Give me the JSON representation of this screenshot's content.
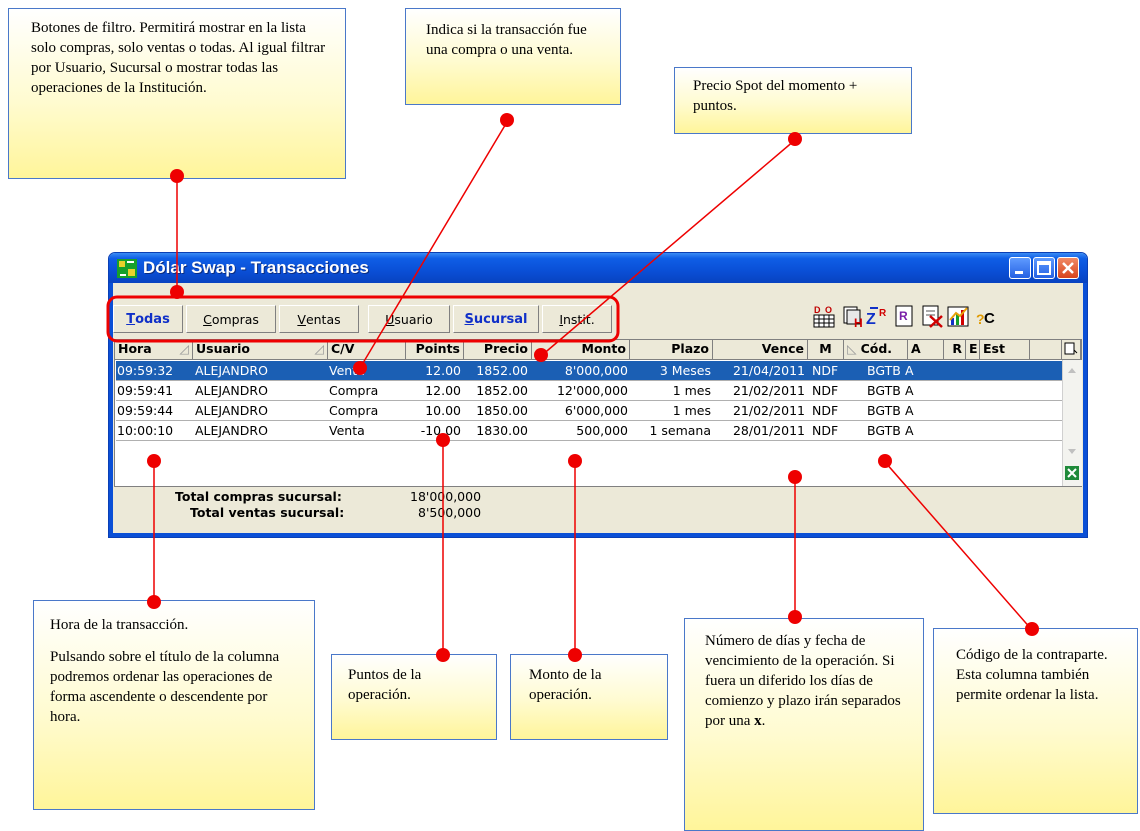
{
  "notes": {
    "filtros": "Botones de filtro. Permitirá mostrar en la lista solo compras, solo ventas o todas. Al igual filtrar por Usuario, Sucursal o mostrar todas las operaciones de la Institución.",
    "cv": "Indica si la transacción fue una compra o una venta.",
    "precio": "Precio Spot del momento + puntos.",
    "hora_p1": "Hora de la transacción.",
    "hora_p2": "Pulsando sobre el título de la columna podremos ordenar las operaciones de forma ascendente o descendente por hora.",
    "puntos": "Puntos de la operación.",
    "monto": "Monto de la operación.",
    "plazo_pre": "Número de días y fecha de vencimiento de la operación. Si fuera un diferido los días de comienzo y plazo irán separados por una ",
    "plazo_bold": "x",
    "plazo_post": ".",
    "codigo": "Código de la contraparte. Esta columna también permite ordenar la lista."
  },
  "window": {
    "title": "Dólar Swap - Transacciones"
  },
  "toolbar": {
    "todas": {
      "ul": "T",
      "rest": "odas"
    },
    "compras": {
      "ul": "C",
      "rest": "ompras"
    },
    "ventas": {
      "ul": "V",
      "rest": "entas"
    },
    "usuario": {
      "ul": "U",
      "rest": "suario"
    },
    "sucursal": {
      "ul": "S",
      "rest": "ucursal"
    },
    "instit": {
      "ul": "I",
      "rest": "nstit."
    }
  },
  "table": {
    "headers": {
      "hora": "Hora",
      "usuario": "Usuario",
      "cv": "C/V",
      "points": "Points",
      "precio": "Precio",
      "monto": "Monto",
      "plazo": "Plazo",
      "vence": "Vence",
      "m": "M",
      "cod": "Cód.",
      "a": "A",
      "r": "R",
      "e": "E",
      "est": "Est"
    },
    "rows": [
      {
        "hora": "09:59:32",
        "usuario": "ALEJANDRO",
        "cv": "Venta",
        "points": "12.00",
        "precio": "1852.00",
        "monto": "8'000,000",
        "plazo": "3 Meses",
        "vence": "21/04/2011",
        "m": "NDF",
        "cod": "BGTB",
        "a": "A"
      },
      {
        "hora": "09:59:41",
        "usuario": "ALEJANDRO",
        "cv": "Compra",
        "points": "12.00",
        "precio": "1852.00",
        "monto": "12'000,000",
        "plazo": "1 mes",
        "vence": "21/02/2011",
        "m": "NDF",
        "cod": "BGTB",
        "a": "A"
      },
      {
        "hora": "09:59:44",
        "usuario": "ALEJANDRO",
        "cv": "Compra",
        "points": "10.00",
        "precio": "1850.00",
        "monto": "6'000,000",
        "plazo": "1 mes",
        "vence": "21/02/2011",
        "m": "NDF",
        "cod": "BGTB",
        "a": "A"
      },
      {
        "hora": "10:00:10",
        "usuario": "ALEJANDRO",
        "cv": "Venta",
        "points": "-10.00",
        "precio": "1830.00",
        "monto": "500,000",
        "plazo": "1 semana",
        "vence": "28/01/2011",
        "m": "NDF",
        "cod": "BGTB",
        "a": "A"
      }
    ]
  },
  "totals": {
    "compras_label": "Total compras sucursal:",
    "compras_value": "18'000,000",
    "ventas_label": "Total ventas sucursal:",
    "ventas_value": "8'500,000"
  },
  "colors": {
    "note_border": "#4a78c9",
    "callout_red": "#ee0000",
    "selected_row": "#1b5fb4",
    "title_blue": "#0a4fd6",
    "active_filter_text": "#1030c8"
  }
}
